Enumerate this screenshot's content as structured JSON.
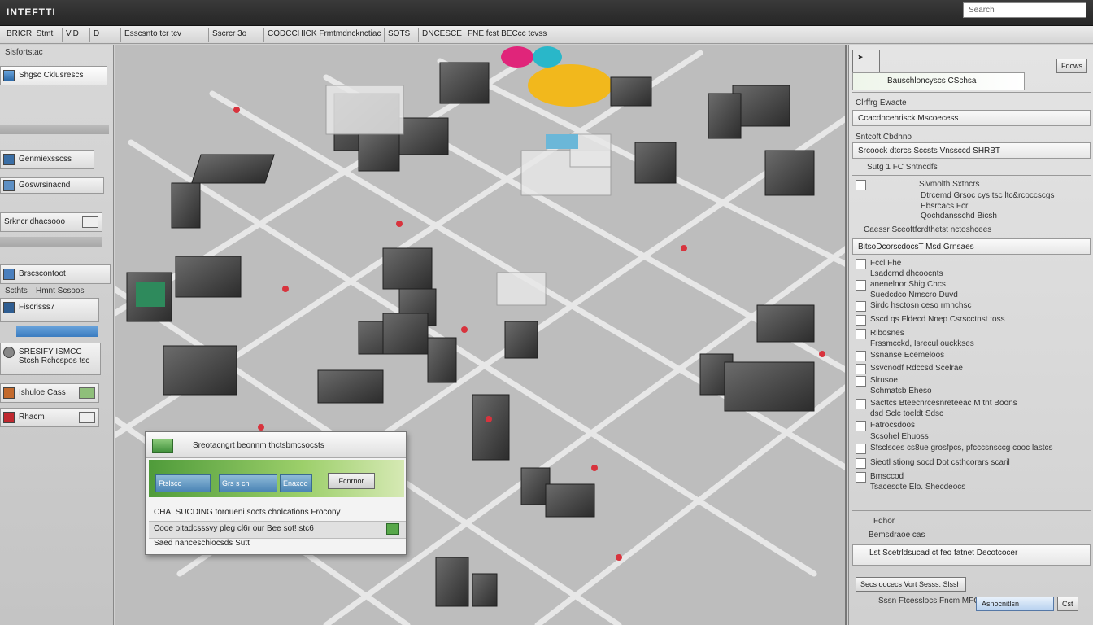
{
  "window": {
    "title": "INTEFTTI",
    "search_placeholder": "Search"
  },
  "menu": {
    "items": [
      "BRICR. Stmt",
      "V'D",
      "D",
      "Esscsnto tcr tcv",
      "Sscrcr 3o",
      "CODCCHICK Frmtmdncknctiac",
      "SOTS",
      "DNCESCE",
      "FNE fcst BECcc tcvss"
    ]
  },
  "left_panel": {
    "header": "Sisfortstac",
    "items": [
      "Shgsc Cklusrescs",
      "Genmiexsscss",
      "Goswrsinacnd",
      "Srkncr dhacsooo",
      "Brscscontoot",
      "Scthts",
      "Hmnt Scsoos",
      "Fiscrisss7",
      "SRESIFY ISMCC",
      "Stcsh Rchcspos tsc",
      "Ishuloe Cass",
      "Rhacm"
    ]
  },
  "dialog": {
    "title": "Sreotacngrt beonnm thctsbmcsocsts",
    "tabs": [
      "Ftslscc",
      "Grs s ch",
      "Enaxoo"
    ],
    "ok_label": "Fcnrnor",
    "lines": [
      "CHAI SUCDING toroueni socts cholcations Frocony",
      "Cooe oitadcsssvy pleg cl6r our Bee sot! stc6",
      "Saed nanceschiocsds Sutt"
    ]
  },
  "right_panel": {
    "top_button": "Fdcws",
    "header": "Bauschloncyscs CSchsa",
    "section1": "Clrffrg Ewacte",
    "row_no": "Ccacdncehrisck Mscoecess",
    "section2": "Sntcoft Cbdhno",
    "row_detail": "Srcoock dtcrcs Sccsts Vnssccd SHRBT",
    "row_flags": "Sutg 1 FC Sntncdfs",
    "desc_lines": [
      "Sivmolth Sxtncrs",
      "Dtrcemd Grsoc cys tsc ltc&rcoccscgs",
      "Ebsrcacs Fcr",
      "Qochdansschd Bicsh"
    ],
    "divider": "Caessr Sceoftfcrdthetst nctoshcees",
    "section3": "BitsoDcorscdocsT Msd Grnsaes",
    "list": [
      "Fccl Fhe",
      "Lsadcrnd dhcoocnts",
      "anenelnor Shig Chcs",
      "Suedcdco Nmscro Duvd",
      "Sirdc hsctosn ceso rmhchsc",
      "Sscd qs Fldecd Nnep Csrscctnst toss",
      "Ribosnes",
      "Frssmcckd, Isrecul ouckkses",
      "Ssnanse Ecemeloos",
      "Ssvcnodf Rdccsd Scelrae",
      "Slrusoe",
      "Schmatsb Eheso",
      "Sacttcs Bteecnrcesnreteeac M tnt Boons",
      "dsd Sclc toeldt Sdsc",
      "Fatrocsdoos",
      "Scsohel Ehuoss",
      "Sfsclsces cs8ue grosfpcs, pfcccsnsccg cooc lastcs",
      "Sieotl stiong socd Dot csthcorars scaril",
      "Bmsccod",
      "Tsacesdte Elo. Shecdeocs"
    ],
    "footer_title": "Fdhor",
    "footer_sub": "Bemsdraoe cas",
    "footer_row": "Lst Scetrldsucad ct feo fatnet Decotcocer",
    "footer_button": "Secs oocecs Vort Sesss: Slssh",
    "footer_bottom": "Sssn Ftcesslocs Fncm MFCfl",
    "footer_action": "Asnocnitlsn",
    "footer_count": "Cst"
  },
  "colors": {
    "accent_green": "#4f9b3a",
    "accent_blue": "#3a7cc0",
    "yellow": "#f2b81c",
    "magenta": "#e0257a",
    "cyan": "#29b7c9"
  }
}
